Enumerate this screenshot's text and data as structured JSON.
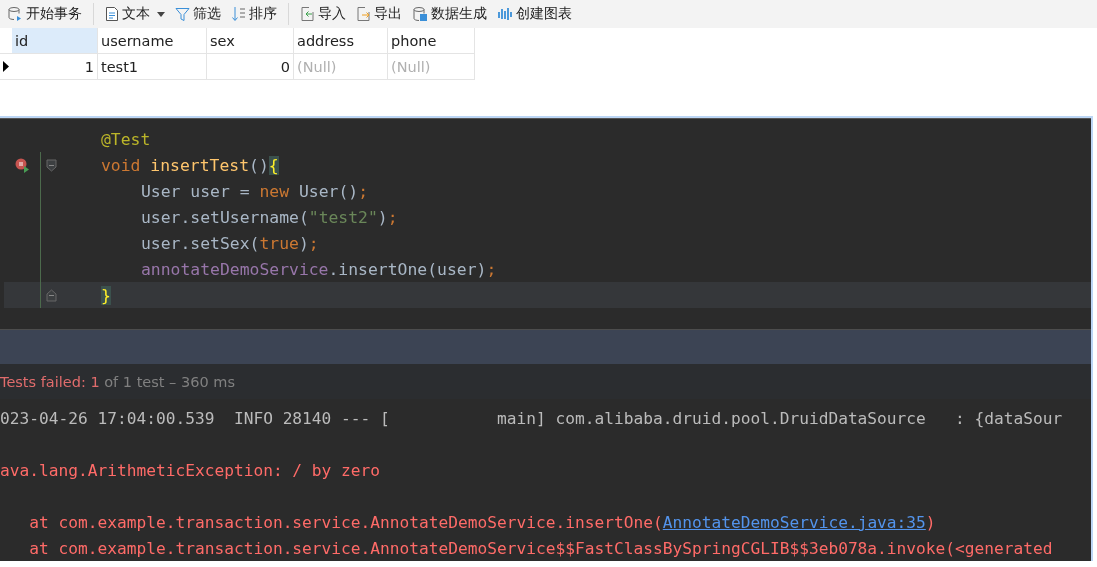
{
  "toolbar": [
    {
      "label": "开始事务",
      "kind": "transaction"
    },
    {
      "label": "文本",
      "kind": "text",
      "dropdown": true
    },
    {
      "label": "筛选",
      "kind": "filter"
    },
    {
      "label": "排序",
      "kind": "sort"
    },
    {
      "label": "导入",
      "kind": "import"
    },
    {
      "label": "导出",
      "kind": "export"
    },
    {
      "label": "数据生成",
      "kind": "generate"
    },
    {
      "label": "创建图表",
      "kind": "chart"
    }
  ],
  "table": {
    "columns": [
      {
        "label": "id",
        "selected": true
      },
      {
        "label": "username",
        "selected": false
      },
      {
        "label": "sex",
        "selected": false
      },
      {
        "label": "address",
        "selected": false
      },
      {
        "label": "phone",
        "selected": false
      }
    ],
    "rows": [
      {
        "current": true,
        "cells": [
          {
            "text": "1",
            "kind": "number"
          },
          {
            "text": "test1",
            "kind": "text"
          },
          {
            "text": "0",
            "kind": "number"
          },
          {
            "text": "(Null)",
            "kind": "null"
          },
          {
            "text": "(Null)",
            "kind": "null"
          }
        ]
      }
    ]
  },
  "editor": {
    "method": {
      "annotation": "@Test",
      "test_failed": true,
      "signature": [
        {
          "text": "void ",
          "kind": "keyword"
        },
        {
          "text": "insertTest",
          "kind": "method"
        },
        {
          "text": "()",
          "kind": "plain"
        },
        {
          "text": "{",
          "kind": "brace"
        }
      ],
      "body": [
        {
          "tokens": [
            {
              "text": "User user = ",
              "kind": "plain"
            },
            {
              "text": "new ",
              "kind": "keyword"
            },
            {
              "text": "User()",
              "kind": "plain"
            },
            {
              "text": ";",
              "kind": "keyword"
            }
          ]
        },
        {
          "tokens": [
            {
              "text": "user.setUsername(",
              "kind": "plain"
            },
            {
              "text": "\"test2\"",
              "kind": "string"
            },
            {
              "text": ")",
              "kind": "plain"
            },
            {
              "text": ";",
              "kind": "keyword"
            }
          ]
        },
        {
          "tokens": [
            {
              "text": "user.setSex(",
              "kind": "plain"
            },
            {
              "text": "true",
              "kind": "keyword"
            },
            {
              "text": ")",
              "kind": "plain"
            },
            {
              "text": ";",
              "kind": "keyword"
            }
          ]
        },
        {
          "tokens": [
            {
              "text": "annotateDemoService",
              "kind": "field"
            },
            {
              "text": ".insertOne(user)",
              "kind": "plain"
            },
            {
              "text": ";",
              "kind": "keyword"
            }
          ]
        }
      ],
      "closing": "}",
      "closing_current": true
    }
  },
  "status": {
    "failed_label": "Tests failed: ",
    "failed_count": "1",
    "summary": "of 1 test – 360 ms"
  },
  "console": [
    {
      "kind": "info",
      "text": "023-04-26 17:04:00.539  INFO 28140 --- [           main] com.alibaba.druid.pool.DruidDataSource   : {dataSour"
    },
    {
      "kind": "error",
      "text": "ava.lang.ArithmeticException: / by zero"
    },
    {
      "kind": "trace",
      "text": "   at com.example.transaction.service.AnnotateDemoService.insertOne(",
      "link": "AnnotateDemoService.java:35",
      "after": ")"
    },
    {
      "kind": "trace",
      "text": "   at com.example.transaction.service.AnnotateDemoService$$FastClassBySpringCGLIB$$3eb078a.invoke(<generated"
    }
  ]
}
